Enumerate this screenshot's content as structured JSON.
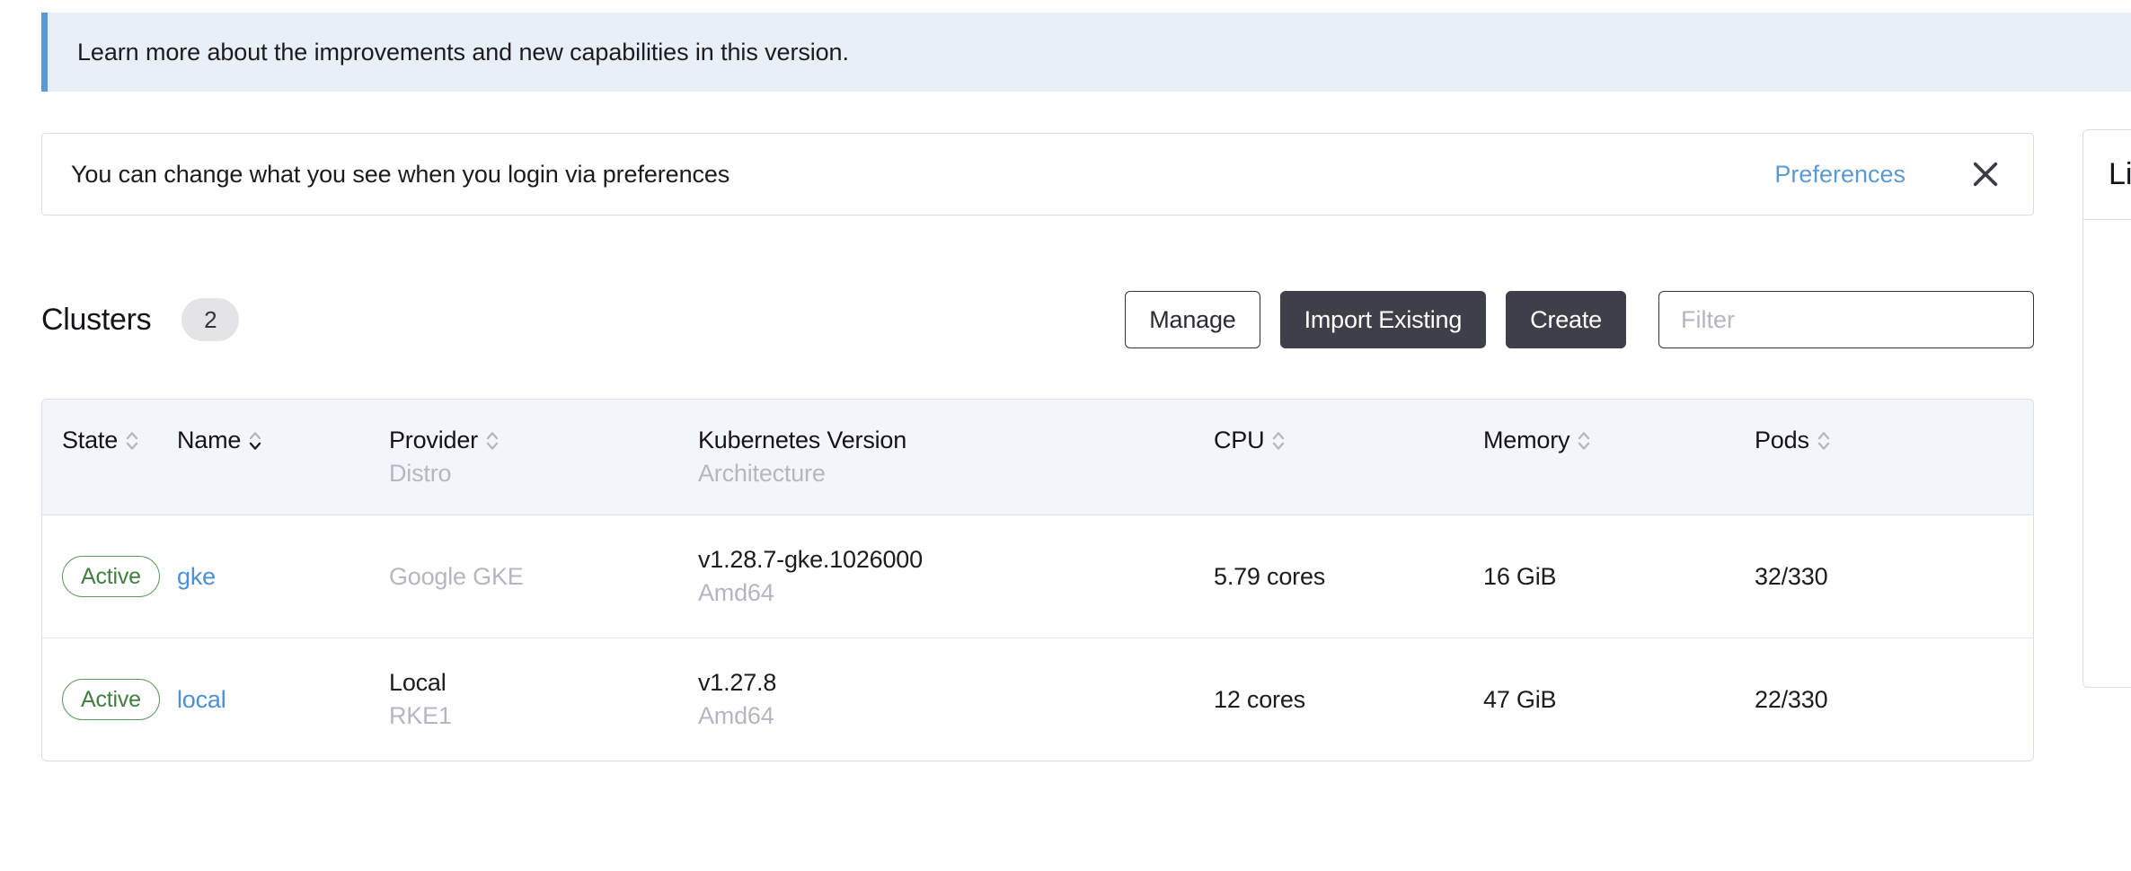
{
  "version_banner": {
    "text": "Learn more about the improvements and new capabilities in this version.",
    "accent_color": "#5b9bd5",
    "background_color": "#e8eff7"
  },
  "preferences_notice": {
    "text": "You can change what you see when you login via preferences",
    "link_label": "Preferences",
    "link_color": "#5b9bd5",
    "close_icon": "close-icon"
  },
  "header": {
    "title": "Clusters",
    "count": "2",
    "buttons": [
      {
        "label": "Manage",
        "style": "outline"
      },
      {
        "label": "Import Existing",
        "style": "solid"
      },
      {
        "label": "Create",
        "style": "solid"
      }
    ],
    "filter": {
      "placeholder": "Filter",
      "value": ""
    }
  },
  "table": {
    "columns": [
      {
        "label": "State",
        "sub": "",
        "sortable": true,
        "sorted": "none"
      },
      {
        "label": "Name",
        "sub": "",
        "sortable": true,
        "sorted": "asc"
      },
      {
        "label": "Provider",
        "sub": "Distro",
        "sortable": true,
        "sorted": "none"
      },
      {
        "label": "Kubernetes Version",
        "sub": "Architecture",
        "sortable": false,
        "sorted": "none"
      },
      {
        "label": "CPU",
        "sub": "",
        "sortable": true,
        "sorted": "none"
      },
      {
        "label": "Memory",
        "sub": "",
        "sortable": true,
        "sorted": "none"
      },
      {
        "label": "Pods",
        "sub": "",
        "sortable": true,
        "sorted": "none"
      }
    ],
    "rows": [
      {
        "state": "Active",
        "name": "gke",
        "provider": "Google GKE",
        "provider_muted": true,
        "distro": "",
        "kubernetes_version": "v1.28.7-gke.1026000",
        "architecture": "Amd64",
        "cpu": "5.79 cores",
        "memory": "16 GiB",
        "pods": "32/330"
      },
      {
        "state": "Active",
        "name": "local",
        "provider": "Local",
        "provider_muted": false,
        "distro": "RKE1",
        "kubernetes_version": "v1.27.8",
        "architecture": "Amd64",
        "cpu": "12 cores",
        "memory": "47 GiB",
        "pods": "22/330"
      }
    ]
  },
  "side_card": {
    "title": "Li"
  },
  "colors": {
    "link": "#4a91d6",
    "active_border": "#5d9b5d",
    "active_text": "#417f41",
    "button_solid": "#3f3f4a",
    "muted_text": "#b6b6c2",
    "table_header_bg": "#f4f5fa",
    "border": "#dcdee7"
  }
}
